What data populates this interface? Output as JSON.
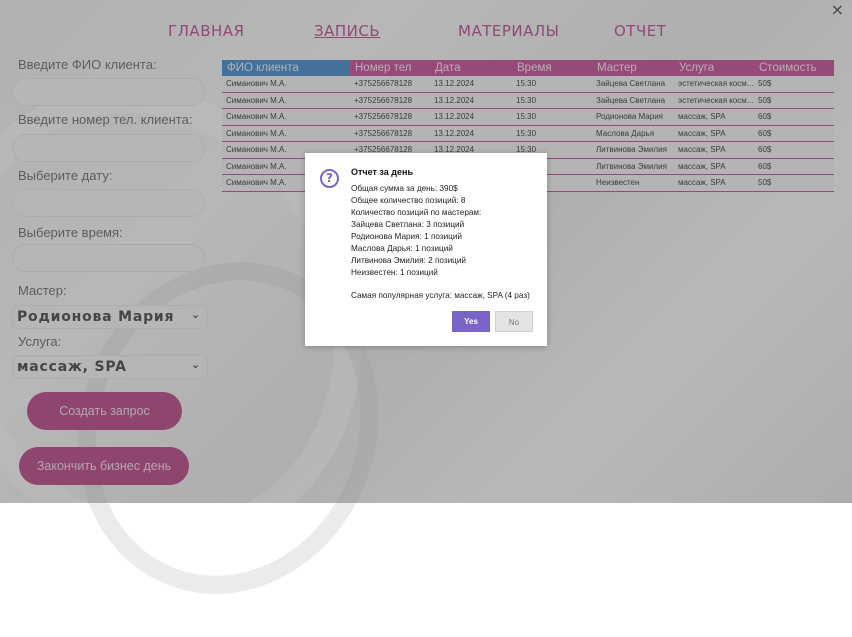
{
  "nav": {
    "items": [
      "ГЛАВНАЯ",
      "ЗАПИСЬ",
      "МАТЕРИАЛЫ",
      "ОТЧЕТ"
    ],
    "active": "ЗАПИСЬ",
    "close_label": "×"
  },
  "form": {
    "fio_label": "Введите ФИО клиента:",
    "phone_label": "Введите номер тел. клиента:",
    "date_label": "Выберите дату:",
    "time_label": "Выберите время:",
    "master_label": "Мастер:",
    "master_value": "Родионова Мария",
    "service_label": "Услуга:",
    "service_value": "массаж, SPA",
    "chevron": "⌄",
    "create_button": "Создать запрос",
    "end_day_button": "Закончить бизнес день"
  },
  "table": {
    "headers": [
      "ФИО клиента",
      "Номер тел",
      "Дата",
      "Время",
      "Мастер",
      "Услуга",
      "Стоимость"
    ],
    "rows": [
      [
        "Симанович М.А.",
        "+375256678128",
        "13.12.2024",
        "15:30",
        "Зайцева Светлана",
        "эстетическая косм...",
        "50$"
      ],
      [
        "Симанович М.А.",
        "+375256678128",
        "13.12.2024",
        "15:30",
        "Зайцева Светлана",
        "эстетическая косм...",
        "50$"
      ],
      [
        "Симанович М.А.",
        "+375256678128",
        "13.12.2024",
        "15:30",
        "Родионова Мария",
        "массаж, SPA",
        "60$"
      ],
      [
        "Симанович М.А.",
        "+375256678128",
        "13.12.2024",
        "15:30",
        "Маслова Дарья",
        "массаж, SPA",
        "60$"
      ],
      [
        "Симанович М.А.",
        "+375256678128",
        "13.12.2024",
        "15:30",
        "Литвинова Эмилия",
        "массаж, SPA",
        "60$"
      ],
      [
        "Симанович М.А.",
        "+375256678128",
        "13.12.2024",
        "15:30",
        "Литвинова Эмилия",
        "массаж, SPA",
        "60$"
      ],
      [
        "Симанович М.А.",
        "+375256678128",
        "13.12.2024",
        "15:30",
        "Неизвестен",
        "массаж, SPA",
        "50$"
      ]
    ]
  },
  "dialog": {
    "icon": "?",
    "title": "Отчет за день",
    "lines": [
      "Общая сумма за день: 390$",
      "Общее количество позиций: 8",
      "Количество позиций по мастерам:",
      "Зайцева Светлана: 3 позиций",
      "Родионова Мария: 1 позиций",
      "Маслова Дарья: 1 позиций",
      "Литвинова Эмилия: 2 позиций",
      "Неизвестен: 1 позиций"
    ],
    "popular": "Самая популярная услуга: массаж, SPA (4 раз)",
    "yes_label": "Yes",
    "no_label": "No"
  },
  "colors": {
    "accent": "#c0398c",
    "header_first": "#2f7fc4",
    "dialog_button": "#7a64c7"
  }
}
